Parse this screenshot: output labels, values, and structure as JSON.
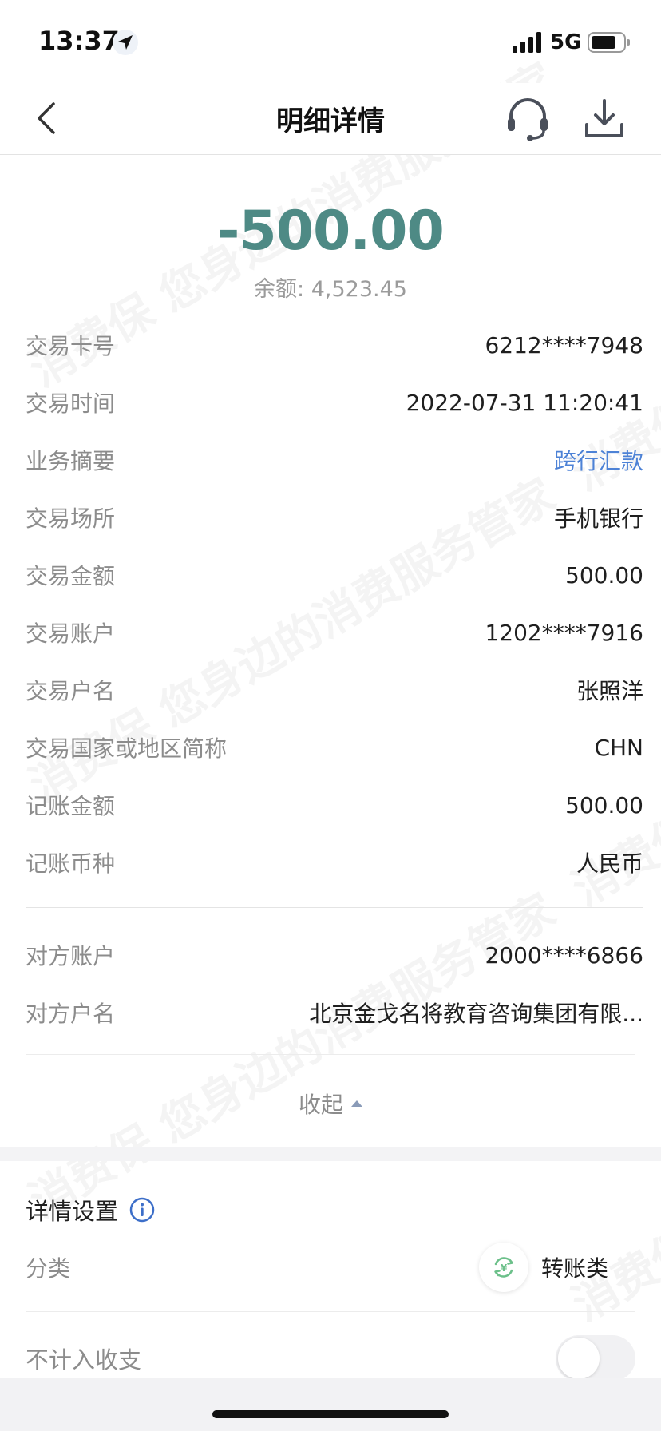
{
  "status_bar": {
    "time": "13:37",
    "network": "5G",
    "icons": [
      "location-arrow-icon",
      "signal-bars-icon",
      "battery-icon"
    ]
  },
  "nav": {
    "title": "明细详情",
    "icons": [
      "chevron-left-icon",
      "headset-icon",
      "download-icon"
    ]
  },
  "summary": {
    "amount": "-500.00",
    "balance": "余额: 4,523.45",
    "amount_color": "#4e8a85"
  },
  "details": [
    {
      "label": "交易卡号",
      "value": "6212****7948"
    },
    {
      "label": "交易时间",
      "value": "2022-07-31 11:20:41"
    },
    {
      "label": "业务摘要",
      "value": "跨行汇款"
    },
    {
      "label": "交易场所",
      "value": "手机银行"
    },
    {
      "label": "交易金额",
      "value": "500.00"
    },
    {
      "label": "交易账户",
      "value": "1202****7916"
    },
    {
      "label": "交易户名",
      "value": "张照洋"
    },
    {
      "label": "交易国家或地区简称",
      "value": "CHN"
    },
    {
      "label": "记账金额",
      "value": "500.00"
    },
    {
      "label": "记账币种",
      "value": "人民币"
    }
  ],
  "counterparty": [
    {
      "label": "对方账户",
      "value": "2000****6866"
    },
    {
      "label": "对方户名",
      "value": "北京金戈名将教育咨询集团有限..."
    }
  ],
  "collapse_label": "收起",
  "settings": {
    "title": "详情设置",
    "category_label": "分类",
    "category_value": "转账类",
    "exclude_label": "不计入收支",
    "exclude_enabled": false
  },
  "watermark_text": "消费保 您身边的消费服务管家",
  "link_color": "#4d82d6"
}
